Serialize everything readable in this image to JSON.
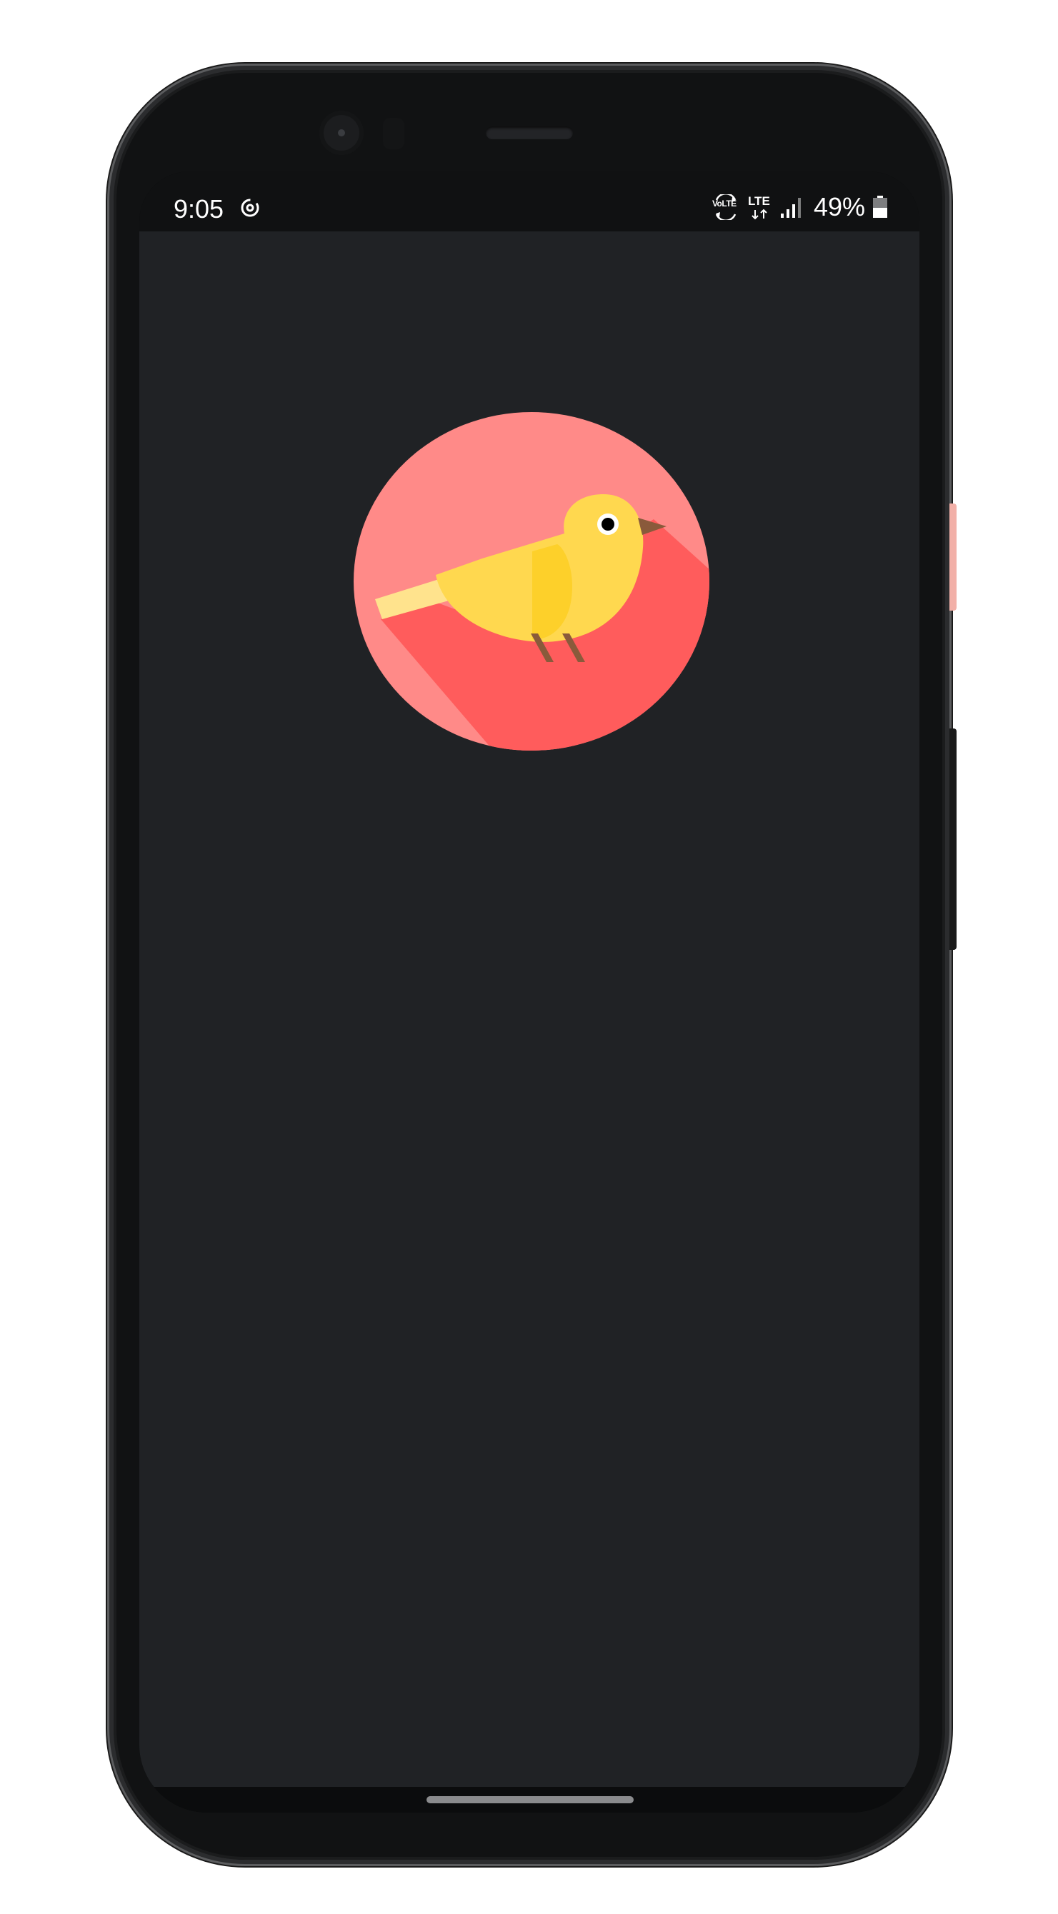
{
  "status_bar": {
    "time": "9:05",
    "sync_icon": "data-saver-icon",
    "volte_label": "VoLTE",
    "network_label": "LTE",
    "signal_icon": "cell-signal-icon",
    "battery_percent": "49%",
    "battery_icon": "battery-icon"
  },
  "app": {
    "logo_icon": "yellow-bird-logo",
    "background_color": "#202225",
    "logo_colors": {
      "circle": "#ff8a88",
      "shadow": "#ff5c5c",
      "bird_body": "#ffd84f",
      "bird_wing": "#fdd02a",
      "tail": "#ffe38d",
      "legs": "#8a5a3b",
      "beak": "#8a5a3b",
      "eye": "#000000"
    }
  },
  "navigation": {
    "home_handle_icon": "gesture-handle"
  }
}
